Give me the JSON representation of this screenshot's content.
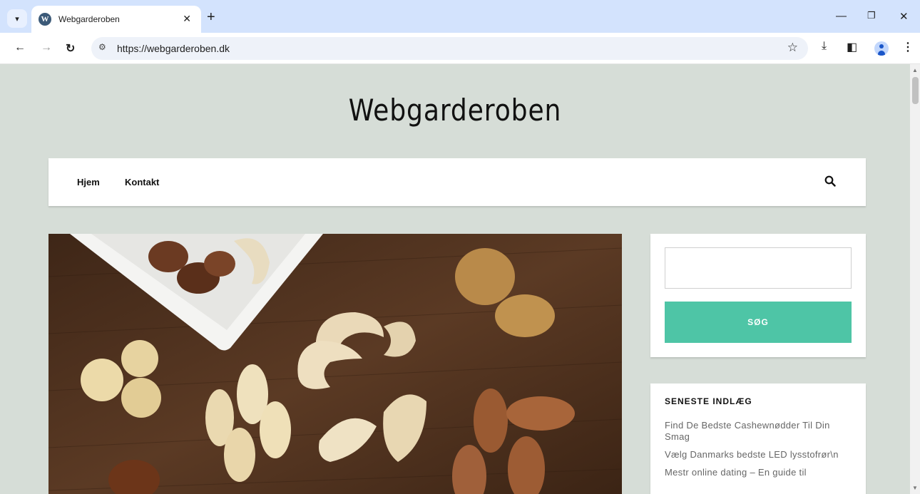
{
  "browser": {
    "tab_title": "Webgarderoben",
    "tab_close": "✕",
    "new_tab": "+",
    "url": "https://webgarderoben.dk",
    "favicon_letter": "W"
  },
  "site": {
    "title": "Webgarderoben",
    "nav": [
      "Hjem",
      "Kontakt"
    ]
  },
  "sidebar": {
    "search_button": "SØG",
    "recent_heading": "SENESTE INDLÆG",
    "recent_posts": [
      "Find De Bedste Cashewnødder Til Din Smag",
      "Vælg Danmarks bedste LED lysstofrør\\n",
      "Mestr online dating – En guide til"
    ]
  },
  "colors": {
    "page_bg": "#d6ddd7",
    "accent": "#4ec5a6",
    "tabbar": "#d3e3fd"
  }
}
